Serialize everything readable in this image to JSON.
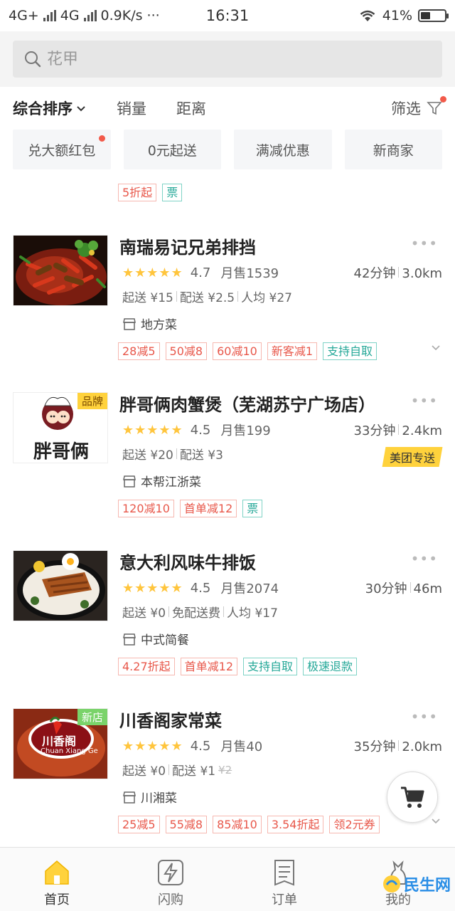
{
  "status_bar": {
    "network1": "4G+",
    "network2": "4G",
    "speed": "0.9K/s",
    "dots": "···",
    "time": "16:31",
    "battery": "41%",
    "battery_level": 0.41
  },
  "search": {
    "placeholder": "花甲"
  },
  "sort_bar": {
    "items": [
      "综合排序",
      "销量",
      "距离"
    ],
    "filter_label": "筛选"
  },
  "quick_filters": [
    "兑大额红包",
    "0元起送",
    "满减优惠",
    "新商家"
  ],
  "promo_tags": [
    "5折起",
    "票"
  ],
  "stores": [
    {
      "name": "南瑞易记兄弟排挡",
      "rating": "4.7",
      "sales": "月售1539",
      "time": "42分钟",
      "distance": "3.0km",
      "min_order": "起送 ¥15",
      "delivery_fee": "配送 ¥2.5",
      "per_person": "人均 ¥27",
      "cuisine": "地方菜",
      "tags": [
        "28减5",
        "50减8",
        "60减10",
        "新客减1",
        "支持自取"
      ]
    },
    {
      "name": "胖哥俩肉蟹煲（芜湖苏宁广场店）",
      "corner_badge": "品牌",
      "rating": "4.5",
      "sales": "月售199",
      "time": "33分钟",
      "distance": "2.4km",
      "min_order": "起送 ¥20",
      "delivery_fee": "配送 ¥3",
      "delivery_badge": "美团专送",
      "cuisine": "本帮江浙菜",
      "logo_text": "胖哥俩",
      "tags": [
        "120减10",
        "首单减12",
        "票"
      ]
    },
    {
      "name": "意大利风味牛排饭",
      "rating": "4.5",
      "sales": "月售2074",
      "time": "30分钟",
      "distance": "46m",
      "min_order": "起送 ¥0",
      "delivery_fee": "免配送费",
      "per_person": "人均 ¥17",
      "cuisine": "中式简餐",
      "tags": [
        "4.27折起",
        "首单减12",
        "支持自取",
        "极速退款"
      ]
    },
    {
      "name": "川香阁家常菜",
      "corner_badge": "新店",
      "rating": "4.5",
      "sales": "月售40",
      "time": "35分钟",
      "distance": "2.0km",
      "min_order": "起送 ¥0",
      "delivery_fee": "配送 ¥1",
      "delivery_fee_original": "¥2",
      "cuisine": "川湘菜",
      "logo_text": "川香阁",
      "logo_subtext": "Chuan Xiang Ge",
      "tags": [
        "25减5",
        "55减8",
        "85减10",
        "3.54折起",
        "领2元券"
      ]
    }
  ],
  "bottom_nav": [
    "首页",
    "闪购",
    "订单",
    "我的"
  ],
  "watermark": "民生网",
  "colors": {
    "accent_yellow": "#ffd23c",
    "star": "#ffc53d",
    "tag_red": "#e8574a",
    "tag_teal": "#25a898"
  }
}
